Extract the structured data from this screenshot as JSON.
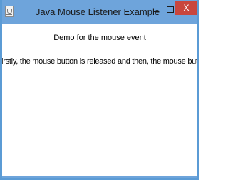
{
  "window": {
    "title": "Java Mouse Listener Example",
    "close_label": "X"
  },
  "icons": {
    "app": "java-app-icon",
    "minimize": "minimize-icon",
    "maximize": "maximize-icon",
    "close": "close-icon"
  },
  "content": {
    "line1": "Demo for the mouse event",
    "line2": "irstly, the mouse button is released and  then, the mouse button is clicked"
  },
  "colors": {
    "titlebar": "#6ea4db",
    "close_button": "#c9463d",
    "content_background": "#ffffff"
  }
}
